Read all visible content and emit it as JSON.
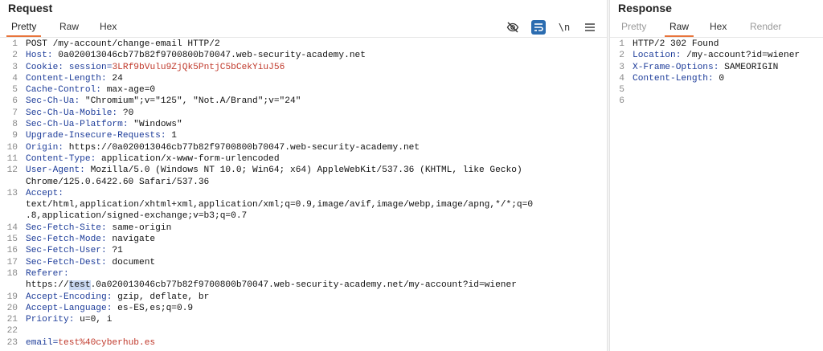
{
  "request": {
    "title": "Request",
    "tabs": [
      "Pretty",
      "Raw",
      "Hex"
    ],
    "active_tab": "Pretty",
    "tools": {
      "hide_icon": "eye-slash-icon",
      "wrap_icon": "wrap-lines-icon",
      "newline_label": "\\n",
      "menu_icon": "hamburger-menu-icon"
    },
    "lines": [
      {
        "n": "1",
        "k": "",
        "v": "POST /my-account/change-email HTTP/2"
      },
      {
        "n": "2",
        "k": "Host",
        "v": " 0a020013046cb77b82f9700800b70047.web-security-academy.net"
      },
      {
        "n": "3",
        "k": "Cookie",
        "v": " ",
        "ck": "session",
        "cv": "3LRf9bVulu9ZjQk5PntjC5bCekYiuJ56"
      },
      {
        "n": "4",
        "k": "Content-Length",
        "v": " 24"
      },
      {
        "n": "5",
        "k": "Cache-Control",
        "v": " max-age=0"
      },
      {
        "n": "6",
        "k": "Sec-Ch-Ua",
        "v": " \"Chromium\";v=\"125\", \"Not.A/Brand\";v=\"24\""
      },
      {
        "n": "7",
        "k": "Sec-Ch-Ua-Mobile",
        "v": " ?0"
      },
      {
        "n": "8",
        "k": "Sec-Ch-Ua-Platform",
        "v": " \"Windows\""
      },
      {
        "n": "9",
        "k": "Upgrade-Insecure-Requests",
        "v": " 1"
      },
      {
        "n": "10",
        "k": "Origin",
        "v": " https://0a020013046cb77b82f9700800b70047.web-security-academy.net"
      },
      {
        "n": "11",
        "k": "Content-Type",
        "v": " application/x-www-form-urlencoded"
      },
      {
        "n": "12",
        "k": "User-Agent",
        "v": " Mozilla/5.0 (Windows NT 10.0; Win64; x64) AppleWebKit/537.36 (KHTML, like Gecko)"
      },
      {
        "n": "",
        "k": "",
        "v": "Chrome/125.0.6422.60 Safari/537.36"
      },
      {
        "n": "13",
        "k": "Accept",
        "v": ""
      },
      {
        "n": "",
        "k": "",
        "v": "text/html,application/xhtml+xml,application/xml;q=0.9,image/avif,image/webp,image/apng,*/*;q=0"
      },
      {
        "n": "",
        "k": "",
        "v": ".8,application/signed-exchange;v=b3;q=0.7"
      },
      {
        "n": "14",
        "k": "Sec-Fetch-Site",
        "v": " same-origin"
      },
      {
        "n": "15",
        "k": "Sec-Fetch-Mode",
        "v": " navigate"
      },
      {
        "n": "16",
        "k": "Sec-Fetch-User",
        "v": " ?1"
      },
      {
        "n": "17",
        "k": "Sec-Fetch-Dest",
        "v": " document"
      },
      {
        "n": "18",
        "k": "Referer",
        "v": ""
      },
      {
        "n": "",
        "k": "",
        "v": "",
        "pre": "https://",
        "hl": "test",
        "post": ".0a020013046cb77b82f9700800b70047.web-security-academy.net/my-account?id=wiener"
      },
      {
        "n": "19",
        "k": "Accept-Encoding",
        "v": " gzip, deflate, br"
      },
      {
        "n": "20",
        "k": "Accept-Language",
        "v": " es-ES,es;q=0.9"
      },
      {
        "n": "21",
        "k": "Priority",
        "v": " u=0, i"
      },
      {
        "n": "22",
        "k": "",
        "v": ""
      },
      {
        "n": "23",
        "k": "",
        "v": "",
        "pk": "email",
        "pv": "test%40cyberhub.es"
      }
    ]
  },
  "response": {
    "title": "Response",
    "tabs": [
      "Pretty",
      "Raw",
      "Hex",
      "Render"
    ],
    "active_tab": "Raw",
    "lines": [
      {
        "n": "1",
        "k": "",
        "v": "HTTP/2 302 Found"
      },
      {
        "n": "2",
        "k": "Location",
        "v": " /my-account?id=wiener"
      },
      {
        "n": "3",
        "k": "X-Frame-Options",
        "v": " SAMEORIGIN"
      },
      {
        "n": "4",
        "k": "Content-Length",
        "v": " 0"
      },
      {
        "n": "5",
        "k": "",
        "v": ""
      },
      {
        "n": "6",
        "k": "",
        "v": ""
      }
    ]
  },
  "colors": {
    "accent": "#e8743b",
    "header_key": "#1e3d9a",
    "cookie_value": "#c0392b",
    "highlight": "#c9d8f2",
    "wrap_button": "#2b6cb0"
  }
}
